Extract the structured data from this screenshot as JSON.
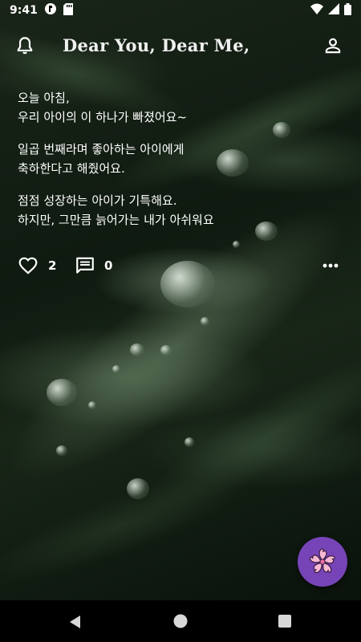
{
  "status_bar": {
    "time": "9:41",
    "icons": [
      "app-notification-icon",
      "sd-card-icon",
      "wifi-icon",
      "signal-icon",
      "battery-icon"
    ]
  },
  "app_bar": {
    "title": "Dear You, Dear Me,",
    "left_icon": "bell-icon",
    "right_icon": "person-icon"
  },
  "post": {
    "paragraphs": [
      [
        "오늘 아침,",
        "우리 아이의 이 하나가 빠졌어요~"
      ],
      [
        "일곱 번째라며 좋아하는 아이에게",
        "축하한다고 해줬어요."
      ],
      [
        "점점 성장하는 아이가 기특해요.",
        "하지만, 그만큼 늙어가는 내가 아쉬워요"
      ]
    ],
    "likes": "2",
    "comments": "0"
  },
  "fab": {
    "icon": "cherry-blossom-icon",
    "color": "#7744b8"
  },
  "nav": {
    "icons": [
      "back-icon",
      "home-icon",
      "recents-icon"
    ]
  },
  "colors": {
    "text": "#ffffff",
    "fab": "#7744b8",
    "background": "#0c120c"
  }
}
